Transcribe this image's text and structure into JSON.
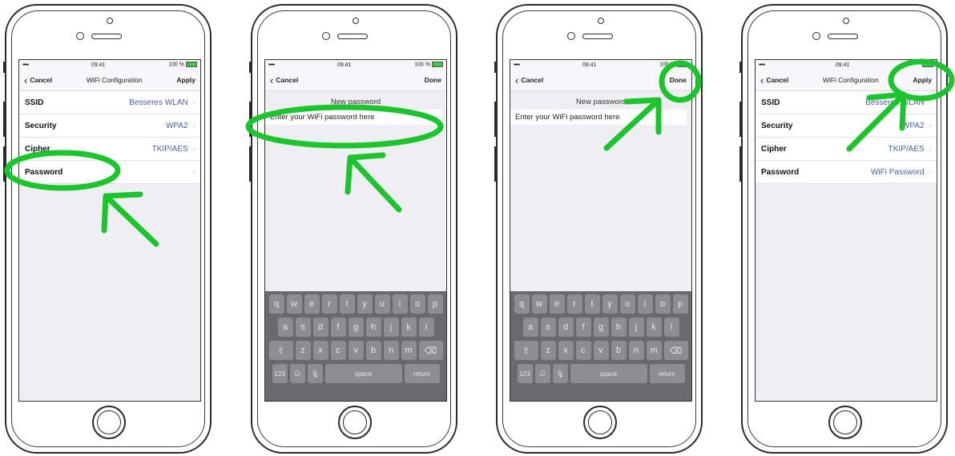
{
  "colors": {
    "annotation": "#1cc42e",
    "value_text": "#4a5d9c"
  },
  "phones": [
    {
      "status": {
        "signal": "••••• ",
        "time": "09:41",
        "battery": "100 %"
      },
      "nav": {
        "back": "Cancel",
        "title": "WiFi Configuration",
        "action": "Apply"
      },
      "rows": [
        {
          "label": "SSID",
          "value": "Besseres WLAN"
        },
        {
          "label": "Security",
          "value": "WPA2"
        },
        {
          "label": "Cipher",
          "value": "TKIP/AES"
        },
        {
          "label": "Password",
          "value": ""
        }
      ]
    },
    {
      "status": {
        "signal": "••••• ",
        "time": "09:41",
        "battery": "100 %"
      },
      "nav": {
        "back": "Cancel",
        "title": "",
        "action": "Done"
      },
      "password_header": "New password",
      "password_placeholder": "Enter your WiFi password here",
      "keyboard": {
        "row1": [
          "q",
          "w",
          "e",
          "r",
          "t",
          "y",
          "u",
          "i",
          "o",
          "p"
        ],
        "row2": [
          "a",
          "s",
          "d",
          "f",
          "g",
          "h",
          "j",
          "k",
          "l"
        ],
        "row3": [
          "z",
          "x",
          "c",
          "v",
          "b",
          "n",
          "m"
        ],
        "shift": "⇧",
        "backspace": "⌫",
        "numbers": "123",
        "emoji": "☺",
        "mic": "🎙",
        "space": "space",
        "return": "return"
      }
    },
    {
      "status": {
        "signal": "••••• ",
        "time": "09:41",
        "battery": "100 %"
      },
      "nav": {
        "back": "Cancel",
        "title": "",
        "action": "Done"
      },
      "password_header": "New password",
      "password_placeholder": "Enter your WiFi password here",
      "keyboard": {
        "row1": [
          "q",
          "w",
          "e",
          "r",
          "t",
          "y",
          "u",
          "i",
          "o",
          "p"
        ],
        "row2": [
          "a",
          "s",
          "d",
          "f",
          "g",
          "h",
          "j",
          "k",
          "l"
        ],
        "row3": [
          "z",
          "x",
          "c",
          "v",
          "b",
          "n",
          "m"
        ],
        "shift": "⇧",
        "backspace": "⌫",
        "numbers": "123",
        "emoji": "☺",
        "mic": "🎙",
        "space": "space",
        "return": "return"
      }
    },
    {
      "status": {
        "signal": "••••• ",
        "time": "09:41",
        "battery": ""
      },
      "nav": {
        "back": "Cancel",
        "title": "WiFi Configuration",
        "action": "Apply"
      },
      "rows": [
        {
          "label": "SSID",
          "value": "Besseres WLAN"
        },
        {
          "label": "Security",
          "value": "WPA2"
        },
        {
          "label": "Cipher",
          "value": "TKIP/AES"
        },
        {
          "label": "Password",
          "value": "WiFi Password"
        }
      ]
    }
  ]
}
